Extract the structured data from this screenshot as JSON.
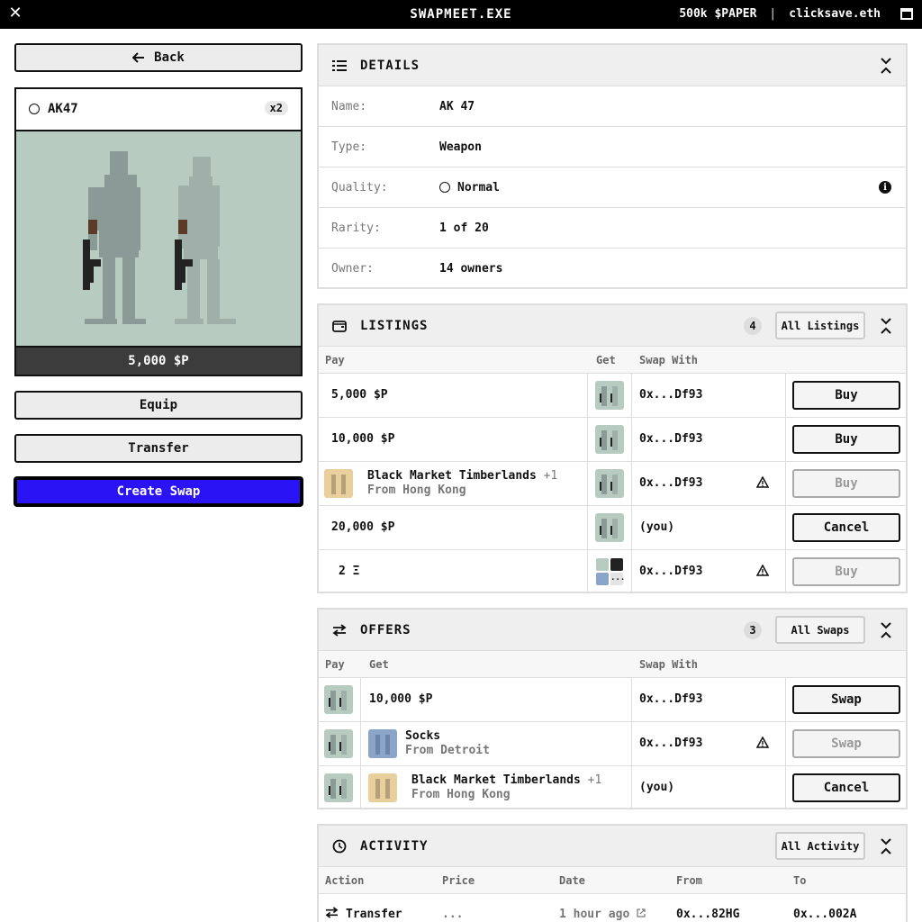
{
  "app": {
    "title": "SWAPMEET.EXE",
    "balance": "500k $PAPER",
    "account": "clicksave.eth"
  },
  "sidebar": {
    "back_label": "Back",
    "item": {
      "name": "AK47",
      "count": "x2",
      "price": "5,000 $P"
    },
    "equip_label": "Equip",
    "transfer_label": "Transfer",
    "create_swap_label": "Create Swap"
  },
  "details": {
    "title": "DETAILS",
    "rows": [
      {
        "label": "Name:",
        "value": "AK 47"
      },
      {
        "label": "Type:",
        "value": "Weapon"
      },
      {
        "label": "Quality:",
        "value": "Normal"
      },
      {
        "label": "Rarity:",
        "value": "1 of 20"
      },
      {
        "label": "Owner:",
        "value": "14 owners"
      }
    ]
  },
  "listings": {
    "title": "LISTINGS",
    "count": "4",
    "all_label": "All Listings",
    "columns": [
      "Pay",
      "Get",
      "Swap With"
    ],
    "rows": [
      {
        "pay": "5,000 $P",
        "swap_with": "0x...Df93",
        "action": "Buy"
      },
      {
        "pay": "10,000 $P",
        "swap_with": "0x...Df93",
        "action": "Buy"
      },
      {
        "pay": "Black Market Timberlands",
        "pay_extra": "+1",
        "pay_sub": "From Hong Kong",
        "swap_with": "0x...Df93",
        "action": "Buy"
      },
      {
        "pay": "20,000 $P",
        "swap_with": "(you)",
        "action": "Cancel"
      },
      {
        "pay": "2 Ξ",
        "swap_with": "0x...Df93",
        "action": "Buy",
        "thumb_more": "..."
      }
    ]
  },
  "offers": {
    "title": "OFFERS",
    "count": "3",
    "all_label": "All Swaps",
    "columns": [
      "Pay",
      "Get",
      "Swap With"
    ],
    "rows": [
      {
        "get": "10,000 $P",
        "swap_with": "0x...Df93",
        "action": "Swap"
      },
      {
        "get": "Socks",
        "get_sub": "From Detroit",
        "swap_with": "0x...Df93",
        "action": "Swap"
      },
      {
        "get": "Black Market Timberlands",
        "get_extra": "+1",
        "get_sub": "From Hong Kong",
        "swap_with": "(you)",
        "action": "Cancel"
      }
    ]
  },
  "activity": {
    "title": "ACTIVITY",
    "all_label": "All Activity",
    "columns": [
      "Action",
      "Price",
      "Date",
      "From",
      "To"
    ],
    "rows": [
      {
        "action": "Transfer",
        "price": "...",
        "date": "1 hour ago",
        "from": "0x...82HG",
        "to": "0x...002A"
      }
    ]
  },
  "colors": {
    "accent": "#2a14f5",
    "art_bg": "#b7cbc0",
    "topbar": "#000000"
  },
  "icons": [
    "close-icon",
    "window-icon",
    "back-arrow-icon",
    "list-icon",
    "wallet-icon",
    "swap-arrows-icon",
    "clock-icon",
    "collapse-icon",
    "info-icon",
    "warning-icon",
    "external-link-icon"
  ]
}
